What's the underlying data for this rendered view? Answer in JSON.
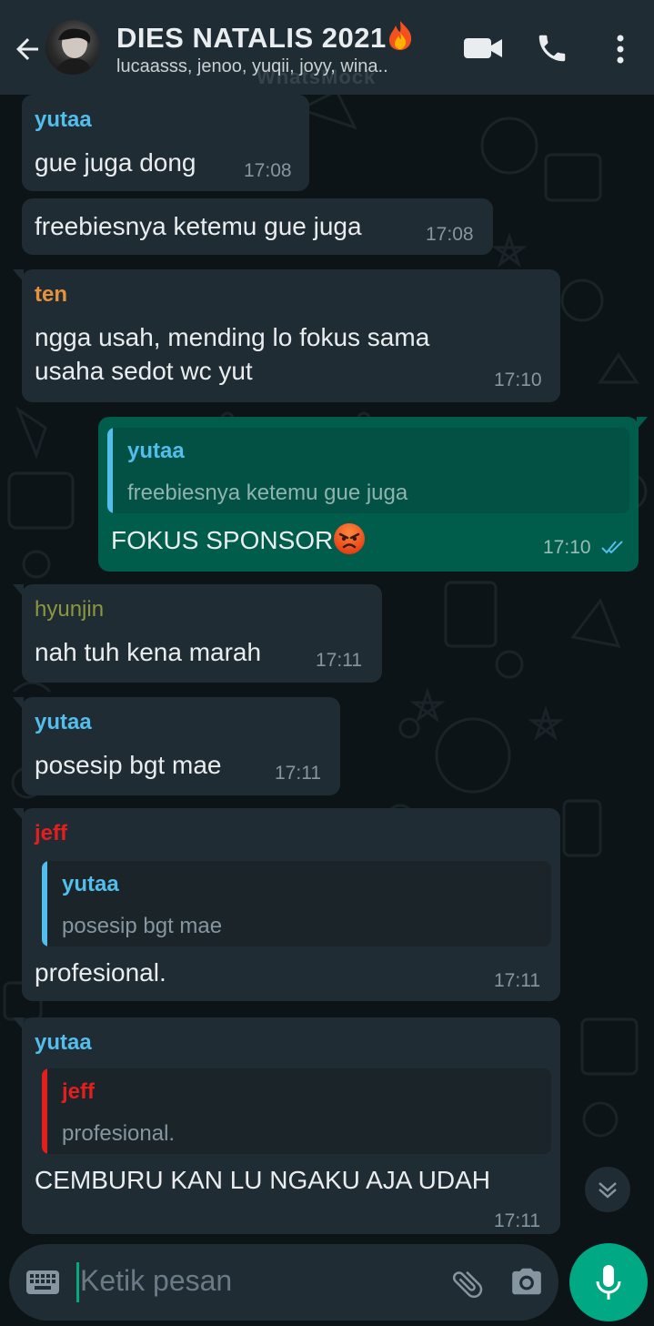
{
  "header": {
    "title": "DIES NATALIS 2021",
    "members": "lucaasss, jenoo, yuqii, joyy, wina..",
    "watermark": "WhatsMock",
    "icons": [
      "back-arrow-icon",
      "video-call-icon",
      "phone-call-icon",
      "more-vert-icon"
    ]
  },
  "colors": {
    "header_bg": "#1f2c34",
    "incoming_bubble": "#202c33",
    "outgoing_bubble": "#005c4b",
    "accent": "#00a884",
    "name_yutaa": "#53bdeb",
    "name_ten": "#e8913c",
    "name_hyunjin": "#8d9740",
    "name_jeff": "#e21f1f",
    "read_ticks": "#53bdeb"
  },
  "messages": [
    {
      "sender": "yutaa",
      "text": "gue juga dong",
      "time": "17:08"
    },
    {
      "text": "freebiesnya ketemu gue juga",
      "time": "17:08"
    },
    {
      "sender": "ten",
      "line1": "ngga usah, mending lo fokus sama",
      "line2": "usaha sedot wc yut",
      "time": "17:10"
    },
    {
      "reply_to": {
        "sender": "yutaa",
        "text": "freebiesnya ketemu gue juga"
      },
      "text": "FOKUS SPONSOR",
      "time": "17:10",
      "status": "read"
    },
    {
      "sender": "hyunjin",
      "text": "nah tuh kena marah",
      "time": "17:11"
    },
    {
      "sender": "yutaa",
      "text": "posesip bgt mae",
      "time": "17:11"
    },
    {
      "sender": "jeff",
      "reply_to": {
        "sender": "yutaa",
        "text": "posesip bgt mae"
      },
      "text": "profesional.",
      "time": "17:11"
    },
    {
      "sender": "yutaa",
      "reply_to": {
        "sender": "jeff",
        "text": "profesional."
      },
      "text": "CEMBURU KAN LU NGAKU AJA UDAH",
      "time": "17:11"
    }
  ],
  "composer": {
    "placeholder": "Ketik pesan",
    "icons": [
      "keyboard-icon",
      "attach-icon",
      "camera-icon",
      "mic-icon"
    ]
  }
}
